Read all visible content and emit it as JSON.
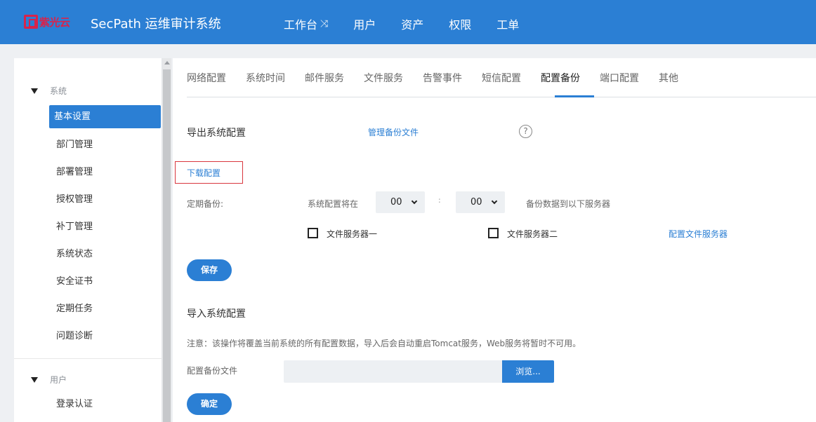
{
  "header": {
    "logo_text": "紫光云",
    "app_title": "SecPath 运维审计系统",
    "nav": [
      "工作台",
      "用户",
      "资产",
      "权限",
      "工单"
    ],
    "workbench_icon": "shuffle-icon",
    "colors": {
      "bar": "#2b7fd4",
      "logo": "#d8234b"
    }
  },
  "sidebar": {
    "groups": [
      {
        "label": "系统",
        "items": [
          "基本设置",
          "部门管理",
          "部署管理",
          "授权管理",
          "补丁管理",
          "系统状态",
          "安全证书",
          "定期任务",
          "问题诊断"
        ],
        "active": "基本设置"
      },
      {
        "label": "用户",
        "items": [
          "登录认证"
        ]
      }
    ]
  },
  "tabs": {
    "items": [
      "网络配置",
      "系统时间",
      "邮件服务",
      "文件服务",
      "告警事件",
      "短信配置",
      "配置备份",
      "端口配置",
      "其他"
    ],
    "active": "配置备份"
  },
  "export": {
    "title": "导出系统配置",
    "manage_link": "管理备份文件",
    "help_icon": "?",
    "download_link": "下载配置",
    "schedule_label": "定期备份:",
    "schedule_prefix": "系统配置将在",
    "hour": "00",
    "separator": ":",
    "minute": "00",
    "schedule_suffix": "备份数据到以下服务器",
    "server_one": "文件服务器一",
    "server_two": "文件服务器二",
    "config_server_link": "配置文件服务器",
    "save_button": "保存"
  },
  "import": {
    "title": "导入系统配置",
    "notice": "注意：该操作将覆盖当前系统的所有配置数据，导入后会自动重启Tomcat服务，Web服务将暂时不可用。",
    "file_label": "配置备份文件",
    "file_value": "",
    "browse_button": "浏览...",
    "confirm_button": "确定"
  }
}
